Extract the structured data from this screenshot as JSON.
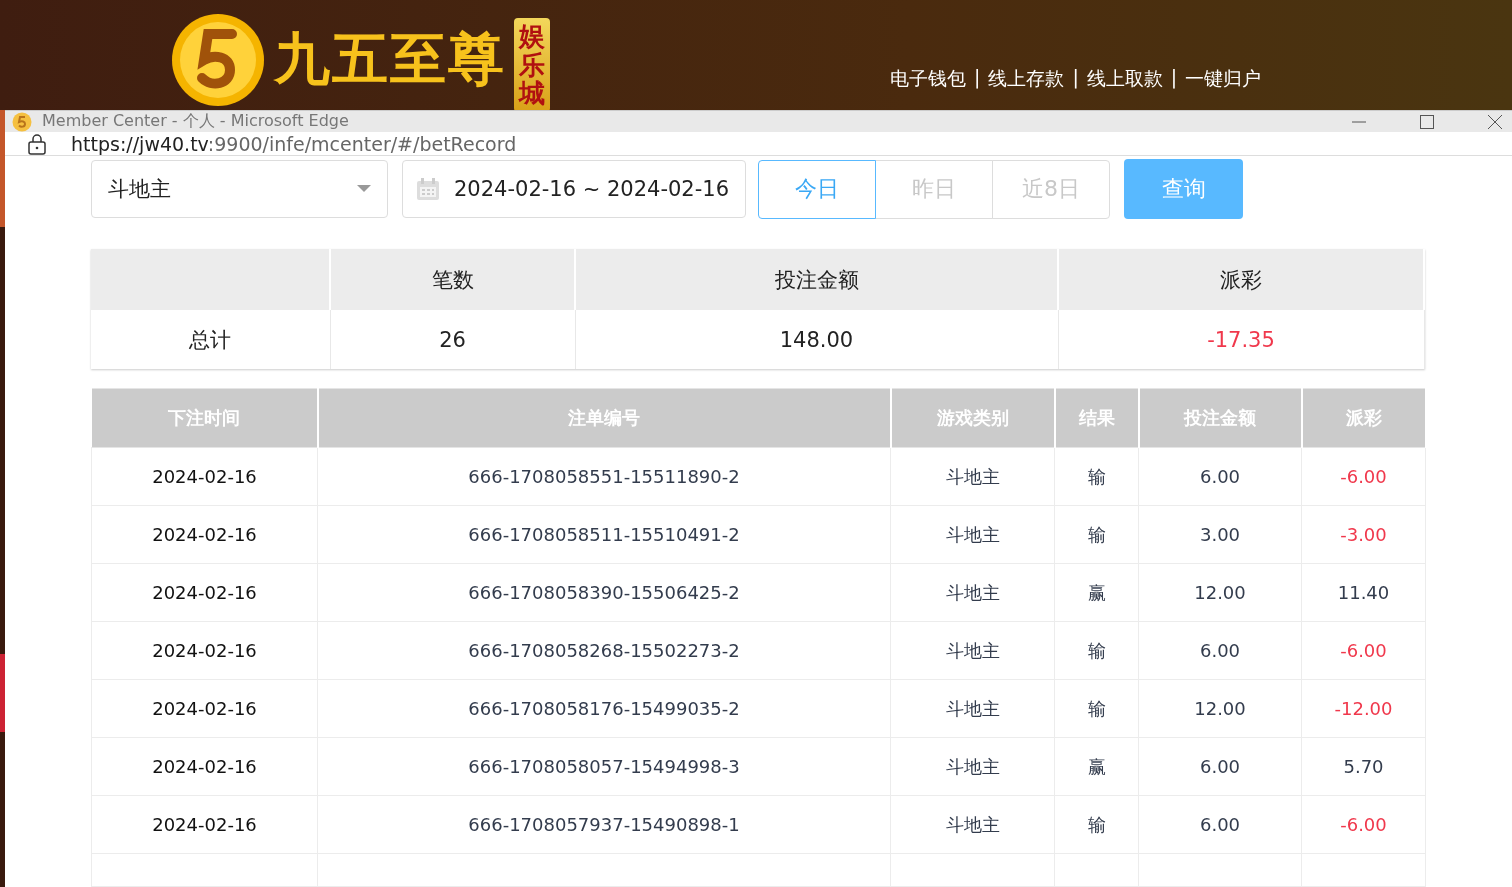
{
  "site": {
    "brand": "九五至尊",
    "badge": "娱乐城",
    "links": [
      "电子钱包",
      "线上存款",
      "线上取款",
      "一键归户"
    ],
    "separator": "|"
  },
  "window": {
    "title": "Member Center - 个人 - Microsoft Edge",
    "url_host": "https://jw40.tv",
    "url_path": ":9900/infe/mcenter/#/betRecord"
  },
  "filters": {
    "game": "斗地主",
    "date_range": "2024-02-16 ~ 2024-02-16",
    "ranges": [
      {
        "label": "今日",
        "selected": true
      },
      {
        "label": "昨日",
        "selected": false
      },
      {
        "label": "近8日",
        "selected": false
      }
    ],
    "query_button": "查询"
  },
  "summary": {
    "columns": [
      "笔数",
      "投注金额",
      "派彩"
    ],
    "row": {
      "label": "总计",
      "count": "26",
      "amount": "148.00",
      "payout": "-17.35",
      "payout_negative": true
    }
  },
  "table": {
    "columns": [
      "下注时间",
      "注单编号",
      "游戏类别",
      "结果",
      "投注金额",
      "派彩"
    ],
    "rows": [
      {
        "time": "2024-02-16",
        "id": "666-1708058551-15511890-2",
        "game": "斗地主",
        "result": "输",
        "amount": "6.00",
        "payout": "-6.00",
        "payout_negative": true
      },
      {
        "time": "2024-02-16",
        "id": "666-1708058511-15510491-2",
        "game": "斗地主",
        "result": "输",
        "amount": "3.00",
        "payout": "-3.00",
        "payout_negative": true
      },
      {
        "time": "2024-02-16",
        "id": "666-1708058390-15506425-2",
        "game": "斗地主",
        "result": "赢",
        "amount": "12.00",
        "payout": "11.40",
        "payout_negative": false
      },
      {
        "time": "2024-02-16",
        "id": "666-1708058268-15502273-2",
        "game": "斗地主",
        "result": "输",
        "amount": "6.00",
        "payout": "-6.00",
        "payout_negative": true
      },
      {
        "time": "2024-02-16",
        "id": "666-1708058176-15499035-2",
        "game": "斗地主",
        "result": "输",
        "amount": "12.00",
        "payout": "-12.00",
        "payout_negative": true
      },
      {
        "time": "2024-02-16",
        "id": "666-1708058057-15494998-3",
        "game": "斗地主",
        "result": "赢",
        "amount": "6.00",
        "payout": "5.70",
        "payout_negative": false
      },
      {
        "time": "2024-02-16",
        "id": "666-1708057937-15490898-1",
        "game": "斗地主",
        "result": "输",
        "amount": "6.00",
        "payout": "-6.00",
        "payout_negative": true
      }
    ]
  }
}
